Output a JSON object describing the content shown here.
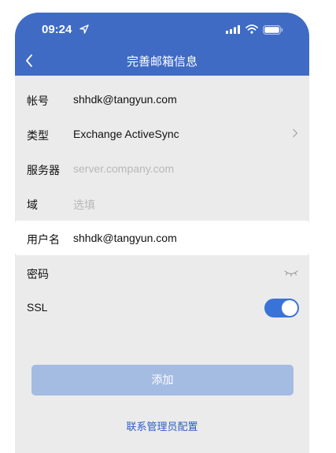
{
  "status_bar": {
    "time": "09:24",
    "icons": [
      "location-arrow-icon",
      "signal-icon",
      "wifi-icon",
      "battery-icon"
    ]
  },
  "nav": {
    "title": "完善邮箱信息",
    "back_icon": "chevron-left-icon"
  },
  "form": {
    "account": {
      "label": "帐号",
      "value": "shhdk@tangyun.com"
    },
    "type": {
      "label": "类型",
      "value": "Exchange ActiveSync"
    },
    "server": {
      "label": "服务器",
      "placeholder": "server.company.com"
    },
    "domain": {
      "label": "域",
      "placeholder": "选填"
    },
    "username": {
      "label": "用户名",
      "value": "shhdk@tangyun.com"
    },
    "password": {
      "label": "密码",
      "value": ""
    },
    "ssl": {
      "label": "SSL",
      "enabled": true
    }
  },
  "actions": {
    "add_label": "添加",
    "admin_config_label": "联系管理员配置"
  },
  "colors": {
    "header": "#3f6bc4",
    "page_bg": "#ebebeb",
    "toggle_on": "#3a73d8",
    "button_disabled": "#a4bbe2",
    "link": "#2f5fbf"
  }
}
